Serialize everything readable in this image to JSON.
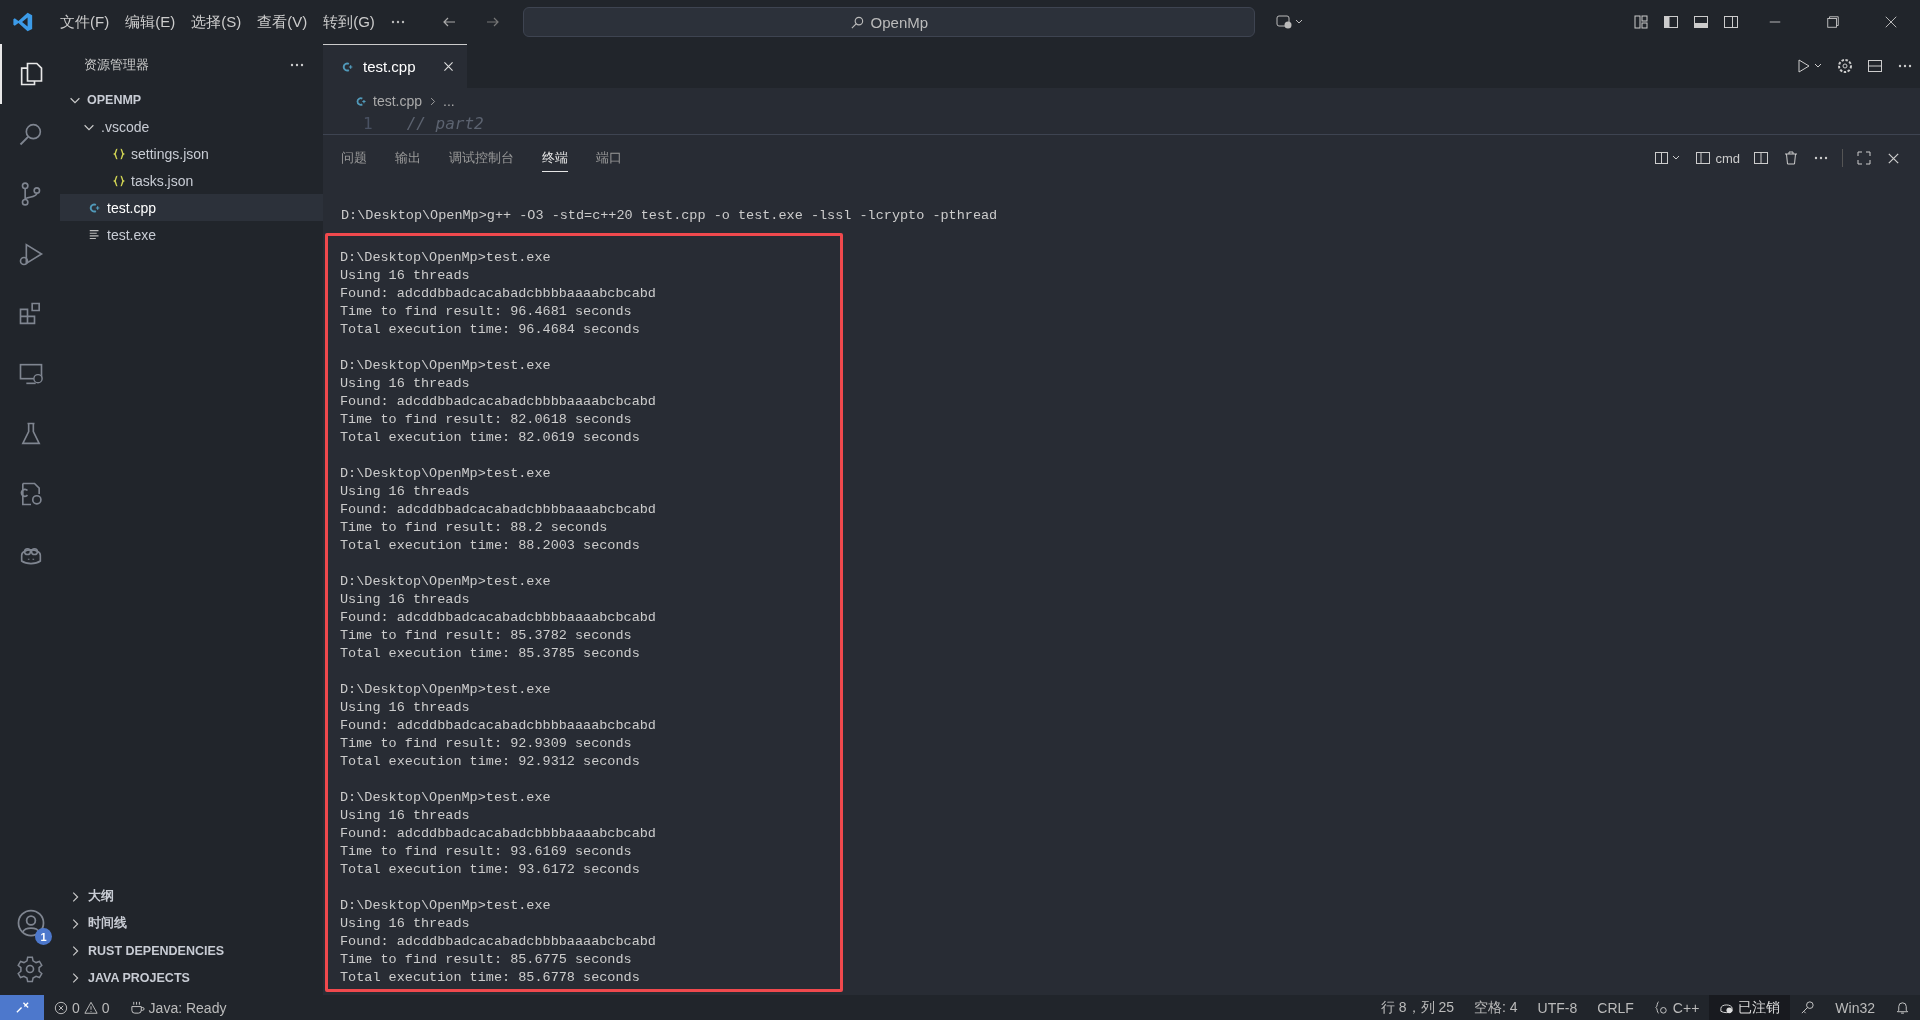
{
  "title_bar": {
    "menu": [
      "文件(F)",
      "编辑(E)",
      "选择(S)",
      "查看(V)",
      "转到(G)"
    ],
    "search": "OpenMp"
  },
  "activity_bar": [
    {
      "kind": "files",
      "selected": true
    },
    {
      "kind": "search",
      "selected": false
    },
    {
      "kind": "source-control",
      "selected": false
    },
    {
      "kind": "run",
      "selected": false
    },
    {
      "kind": "extensions",
      "selected": false
    },
    {
      "kind": "remote",
      "selected": false
    },
    {
      "kind": "testing",
      "selected": false
    },
    {
      "kind": "settings-sync",
      "selected": false
    },
    {
      "kind": "robot",
      "selected": false
    }
  ],
  "account_badge": "1",
  "explorer": {
    "title": "资源管理器",
    "tree": [
      {
        "label": "OPENMP",
        "kind": "root",
        "expanded": true,
        "selected": false,
        "children": [
          {
            "label": ".vscode",
            "kind": "folder",
            "expanded": true,
            "selected": false,
            "children": [
              {
                "label": "settings.json",
                "kind": "json",
                "selected": false
              },
              {
                "label": "tasks.json",
                "kind": "json",
                "selected": false
              }
            ]
          },
          {
            "label": "test.cpp",
            "kind": "cpp",
            "selected": true
          },
          {
            "label": "test.exe",
            "kind": "file",
            "selected": false
          }
        ]
      }
    ],
    "sections": [
      {
        "label": "大纲",
        "expanded": false
      },
      {
        "label": "时间线",
        "expanded": false
      },
      {
        "label": "RUST DEPENDENCIES",
        "expanded": false
      },
      {
        "label": "JAVA PROJECTS",
        "expanded": false
      }
    ]
  },
  "tabs": [
    {
      "label": "test.cpp",
      "selected": true
    }
  ],
  "breadcrumb": [
    "test.cpp",
    "..."
  ],
  "editor": {
    "line_number": "1",
    "code": "// part2"
  },
  "panel": {
    "tabs": [
      {
        "label": "问题",
        "selected": false
      },
      {
        "label": "输出",
        "selected": false
      },
      {
        "label": "调试控制台",
        "selected": false
      },
      {
        "label": "终端",
        "selected": true
      },
      {
        "label": "端口",
        "selected": false
      }
    ],
    "terminal_name": "cmd",
    "command": "D:\\Desktop\\OpenMp>g++ -O3 -std=c++20 test.cpp -o test.exe -lssl -lcrypto -pthread",
    "runs": [
      [
        "D:\\Desktop\\OpenMp>test.exe",
        "Using 16 threads",
        "Found: adcddbbadcacabadcbbbbaaaabcbcabd",
        "Time to find result: 96.4681 seconds",
        "Total execution time: 96.4684 seconds"
      ],
      [
        "D:\\Desktop\\OpenMp>test.exe",
        "Using 16 threads",
        "Found: adcddbbadcacabadcbbbbaaaabcbcabd",
        "Time to find result: 82.0618 seconds",
        "Total execution time: 82.0619 seconds"
      ],
      [
        "D:\\Desktop\\OpenMp>test.exe",
        "Using 16 threads",
        "Found: adcddbbadcacabadcbbbbaaaabcbcabd",
        "Time to find result: 88.2 seconds",
        "Total execution time: 88.2003 seconds"
      ],
      [
        "D:\\Desktop\\OpenMp>test.exe",
        "Using 16 threads",
        "Found: adcddbbadcacabadcbbbbaaaabcbcabd",
        "Time to find result: 85.3782 seconds",
        "Total execution time: 85.3785 seconds"
      ],
      [
        "D:\\Desktop\\OpenMp>test.exe",
        "Using 16 threads",
        "Found: adcddbbadcacabadcbbbbaaaabcbcabd",
        "Time to find result: 92.9309 seconds",
        "Total execution time: 92.9312 seconds"
      ],
      [
        "D:\\Desktop\\OpenMp>test.exe",
        "Using 16 threads",
        "Found: adcddbbadcacabadcbbbbaaaabcbcabd",
        "Time to find result: 93.6169 seconds",
        "Total execution time: 93.6172 seconds"
      ],
      [
        "D:\\Desktop\\OpenMp>test.exe",
        "Using 16 threads",
        "Found: adcddbbadcacabadcbbbbaaaabcbcabd",
        "Time to find result: 85.6775 seconds",
        "Total execution time: 85.6778 seconds"
      ]
    ]
  },
  "status_bar": {
    "errors": "0",
    "warnings": "0",
    "java": "Java: Ready",
    "position": "行 8，列 25",
    "indent": "空格: 4",
    "encoding": "UTF-8",
    "eol": "CRLF",
    "language": "C++",
    "account": "已注销",
    "platform": "Win32"
  }
}
